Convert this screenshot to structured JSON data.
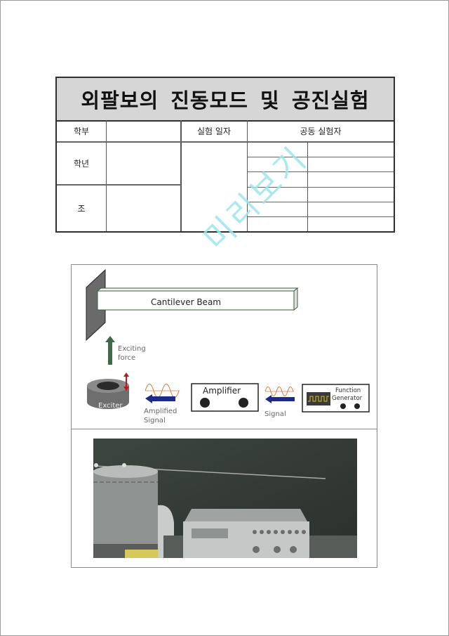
{
  "document": {
    "title": "외팔보의 진동모드 및 공진실험",
    "watermark": "미리보기",
    "info_table": {
      "dept_label": "학부",
      "dept_value": "",
      "year_label": "학년",
      "year_value": "",
      "group_label": "조",
      "group_value": "",
      "date_label": "실험 일자",
      "date_value": "",
      "partners_label": "공동 실험자",
      "partners": [
        "",
        "",
        "",
        "",
        "",
        "",
        "",
        "",
        "",
        "",
        "",
        ""
      ]
    }
  },
  "figure": {
    "diagram": {
      "beam_label": "Cantilever Beam",
      "force_label_line1": "Exciting",
      "force_label_line2": "force",
      "exciter_label": "Exciter",
      "amplified_label_line1": "Amplified",
      "amplified_label_line2": "Signal",
      "amplifier_label": "Amplifier",
      "signal_label": "Signal",
      "generator_label_line1": "Function",
      "generator_label_line2": "Generator",
      "colors": {
        "force_arrow": "#3e6a4a",
        "signal_arrow": "#1c2a8c",
        "wave": "#e07a3a",
        "motion_arrow": "#c01818",
        "generator_wave": "#d8c020"
      }
    },
    "photo": {
      "description": "experiment-photo"
    }
  }
}
